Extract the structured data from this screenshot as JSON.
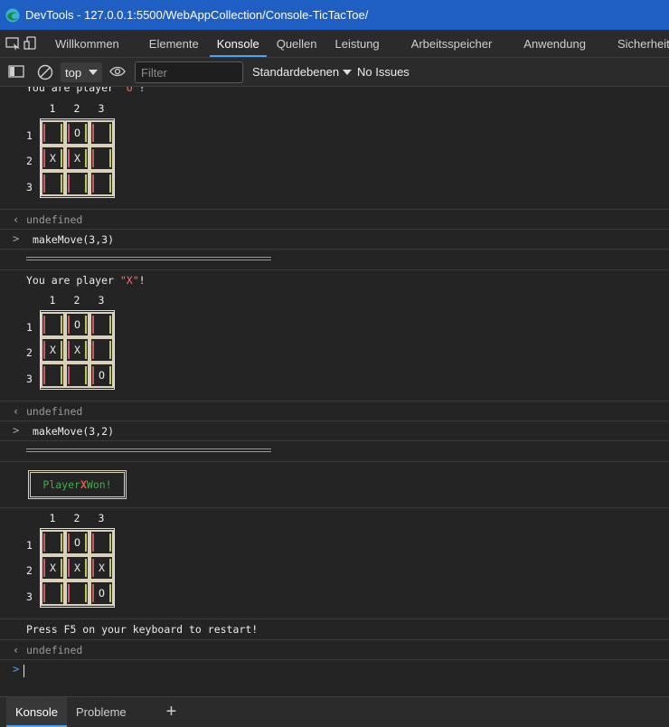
{
  "window": {
    "title": "DevTools - 127.0.0.1:5500/WebAppCollection/Console-TicTacToe/"
  },
  "tabs": [
    {
      "label": "Willkommen"
    },
    {
      "label": "Elemente"
    },
    {
      "label": "Konsole"
    },
    {
      "label": "Quellen"
    },
    {
      "label": "Leistung"
    },
    {
      "label": "Arbeitsspeicher"
    },
    {
      "label": "Anwendung"
    },
    {
      "label": "Sicherheit"
    }
  ],
  "active_tab": "Konsole",
  "toolbar": {
    "context": "top",
    "filter_placeholder": "Filter",
    "levels": "Standardebenen",
    "issues": "No Issues"
  },
  "console": {
    "player_line_prefix": "You are player ",
    "player_o_quoted": "\"O\"",
    "player_x_quoted": "\"X\"",
    "player_line_suffix": "!",
    "col_headers": [
      "1",
      "2",
      "3"
    ],
    "row_headers": [
      "1",
      "2",
      "3"
    ],
    "board_1": [
      [
        "",
        "O",
        ""
      ],
      [
        "X",
        "X",
        ""
      ],
      [
        "",
        "",
        ""
      ]
    ],
    "board_2": [
      [
        "",
        "O",
        ""
      ],
      [
        "X",
        "X",
        ""
      ],
      [
        "",
        "",
        "O"
      ]
    ],
    "board_3": [
      [
        "",
        "O",
        ""
      ],
      [
        "X",
        "X",
        "X"
      ],
      [
        "",
        "",
        "O"
      ]
    ],
    "undefined": "undefined",
    "cmd_1": "makeMove(3,3)",
    "cmd_2": "makeMove(3,2)",
    "win_prefix": "Player ",
    "win_player": "X",
    "win_suffix": " Won!",
    "restart_msg": "Press F5 on your keyboard to restart!"
  },
  "drawer": {
    "tabs": [
      {
        "label": "Konsole"
      },
      {
        "label": "Probleme"
      }
    ],
    "add_label": "+"
  },
  "colors": {
    "titlebar": "#1f5fc4",
    "accent": "#4ea1f3",
    "win_green": "#3fae4a",
    "win_red": "#ff4b4b"
  }
}
